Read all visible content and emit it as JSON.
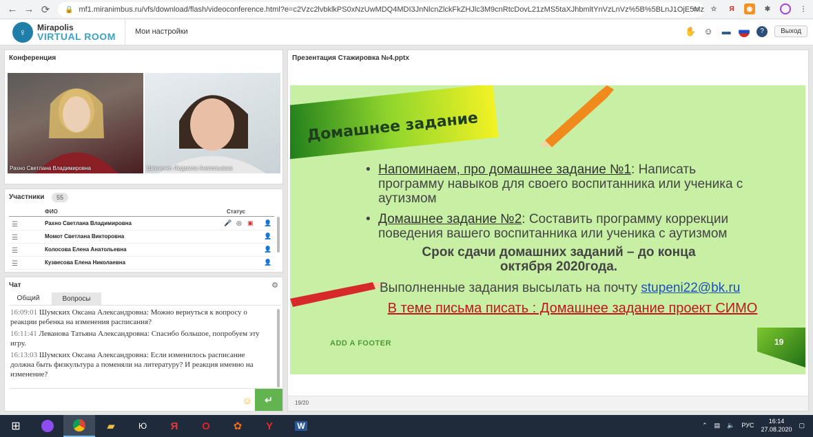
{
  "browser": {
    "url": "mf1.miranimbus.ru/vfs/download/flash/videoconference.html?e=c2Vzc2lvbklkPS0xNzUwMDQ4MDI3JnNlcnZlckFkZHJlc3M9cnRtcDovL21zMS5taXJhbmltYnVzLnVz%5B%5BLnJ1OjE5MzUvdml..."
  },
  "header": {
    "logo_line1": "Mirapolis",
    "logo_line2": "VIRTUAL ROOM",
    "settings_label": "Мои настройки",
    "exit_label": "Выход"
  },
  "conference": {
    "title": "Конференция",
    "videos": [
      {
        "caption": "Рахно Светлана Владимировна"
      },
      {
        "caption": "Шевченко  Людмила  Анатольевна"
      }
    ]
  },
  "participants": {
    "title": "Участники",
    "count": "55",
    "col_name": "ФИО",
    "col_status": "Статус",
    "rows": [
      {
        "name": "Рахно Светлана Владимировна"
      },
      {
        "name": "Момот Светлана   Викторовна"
      },
      {
        "name": "Колосова Елена  Анатольевна"
      },
      {
        "name": "Кузвесова Елена  Николаевна"
      }
    ]
  },
  "chat": {
    "title": "Чат",
    "tabs": [
      "Общий",
      "Вопросы"
    ],
    "messages": [
      {
        "time": "16:09:01",
        "text": "Шумских Оксана  Александровна: Можно вернуться к вопросу о реакции ребенка на изменения расписания?"
      },
      {
        "time": "16:11:41",
        "text": "Леванова Татьяна  Александровна: Спасибо большое, попробуем эту игру."
      },
      {
        "time": "16:13:03",
        "text": "Шумских Оксана  Александровна: Если изменилось расписание должна быть физкультура а поменяли на литературу? И реакция именно на изменение?"
      }
    ]
  },
  "presentation": {
    "title": "Презентация Стажировка №4.pptx",
    "page": "19/20",
    "slide": {
      "heading": "Домашнее  задание",
      "bullet1_u": "Напоминаем, про домашнее задание №1",
      "bullet1_t": ": Написать программу навыков для своего воспитанника или ученика с аутизмом",
      "bullet2_u": "Домашнее задание №2",
      "bullet2_t": ": Составить программу коррекции поведения вашего воспитанника или ученика с аутизмом",
      "deadline": "Срок сдачи домашних заданий – до конца октября 2020года.",
      "email_prefix": "Выполненные задания высылать на почту ",
      "email": "stupeni22@bk.ru",
      "subject": "В теме письма писать : Домашнее задание проект СИМО",
      "footer": "ADD A FOOTER",
      "number": "19"
    }
  },
  "taskbar": {
    "lang": "РУС",
    "time": "16:14",
    "date": "27.08.2020"
  }
}
